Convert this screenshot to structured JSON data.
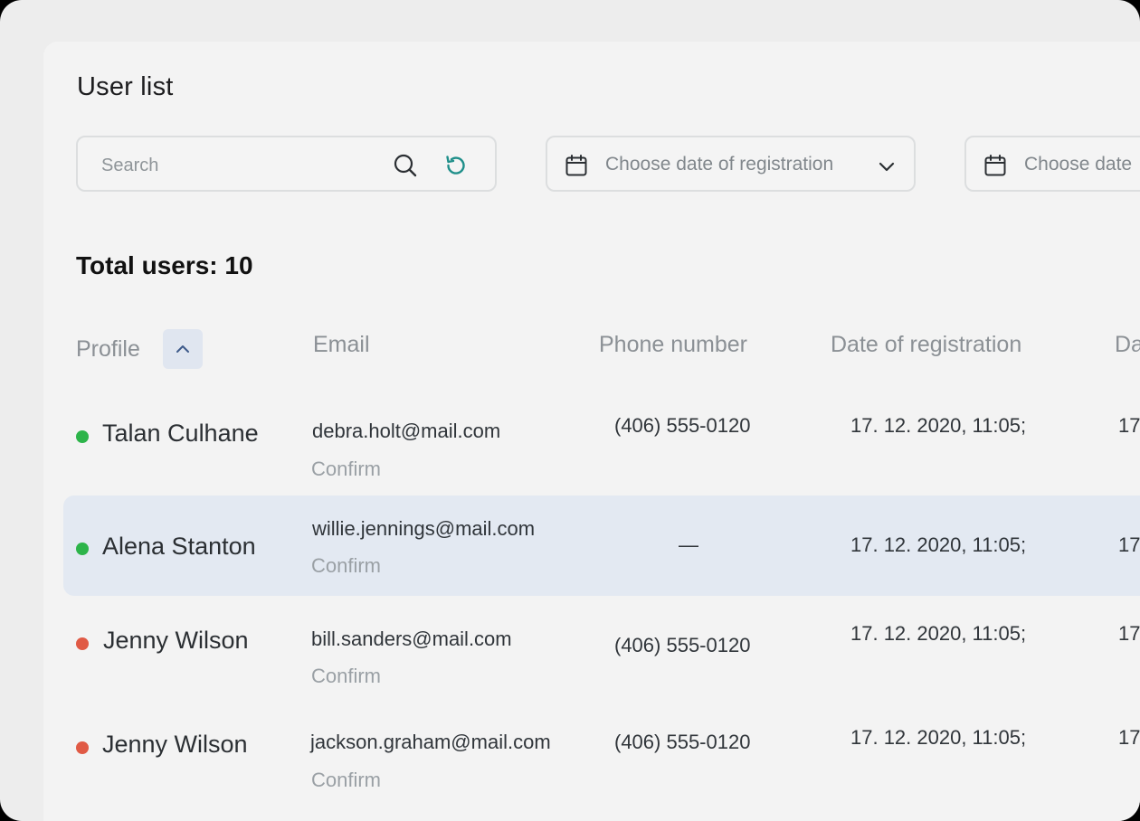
{
  "title": "User list",
  "search": {
    "placeholder": "Search",
    "value": ""
  },
  "filters": {
    "date_registration": "Choose date of registration",
    "date_second": "Choose date"
  },
  "total_label": "Total users: 10",
  "columns": {
    "profile": "Profile",
    "email": "Email",
    "phone": "Phone number",
    "date_registration": "Date of registration",
    "next": "Da"
  },
  "status_colors": {
    "online": "#2db44a",
    "offline": "#e05a45"
  },
  "rows": [
    {
      "name": "Talan Culhane",
      "status": "online",
      "email": "debra.holt@mail.com",
      "action": "Confirm",
      "phone": "(406) 555-0120",
      "date": "17. 12. 2020, 11:05;",
      "date2": "17"
    },
    {
      "name": "Alena Stanton",
      "status": "online",
      "email": "willie.jennings@mail.com",
      "action": "Confirm",
      "phone": "—",
      "date": "17. 12. 2020, 11:05;",
      "date2": "17"
    },
    {
      "name": "Jenny Wilson",
      "status": "offline",
      "email": "bill.sanders@mail.com",
      "action": "Confirm",
      "phone": "(406) 555-0120",
      "date": "17. 12. 2020, 11:05;",
      "date2": "17"
    },
    {
      "name": "Jenny Wilson",
      "status": "offline",
      "email": "jackson.graham@mail.com",
      "action": "Confirm",
      "phone": "(406) 555-0120",
      "date": "17. 12. 2020, 11:05;",
      "date2": "17"
    }
  ],
  "icons": {
    "search": "search-icon",
    "refresh": "refresh-icon",
    "calendar": "calendar-icon",
    "dropdown": "chevron-down-icon",
    "sort": "chevron-up-icon"
  }
}
